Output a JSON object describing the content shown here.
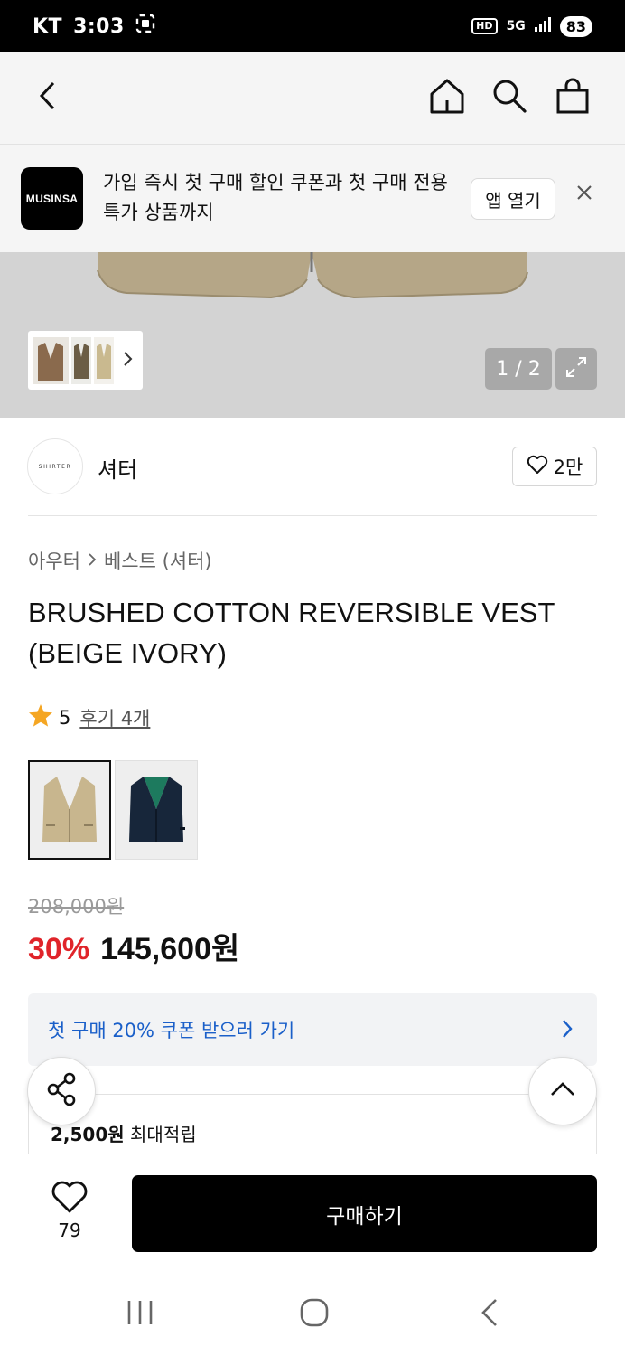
{
  "status_bar": {
    "carrier": "KT",
    "time": "3:03",
    "hd": "HD",
    "network": "5G",
    "battery": "83"
  },
  "top_nav": {
    "back_icon": "chevron-left-icon",
    "home_icon": "home-icon",
    "search_icon": "search-icon",
    "cart_icon": "shopping-bag-icon"
  },
  "app_banner": {
    "logo_text": "MUSINSA",
    "message": "가입 즉시 첫 구매 할인 쿠폰과 첫 구매 전용 특가 상품까지",
    "open_label": "앱 열기",
    "close_icon": "close-icon"
  },
  "hero": {
    "page_indicator": "1 / 2"
  },
  "brand": {
    "logo_text": "SHIRTER",
    "name": "셔터",
    "like_count": "2만"
  },
  "breadcrumb": {
    "category": "아우터",
    "sub_category": "베스트 (셔터)"
  },
  "product": {
    "title": "BRUSHED COTTON REVERSIBLE VEST (BEIGE IVORY)",
    "rating": "5",
    "review_label": "후기 4개"
  },
  "price": {
    "original": "208,000원",
    "discount": "30%",
    "sale": "145,600원"
  },
  "coupon": {
    "label": "첫 구매 20% 쿠폰 받으러 가기"
  },
  "points": {
    "amount": "2,500원",
    "suffix": " 최대적립"
  },
  "bottom_bar": {
    "wish_count": "79",
    "buy_label": "구매하기"
  },
  "colors": {
    "accent_red": "#e0242a",
    "link_blue": "#1a5fc9",
    "star": "#f5a623"
  }
}
